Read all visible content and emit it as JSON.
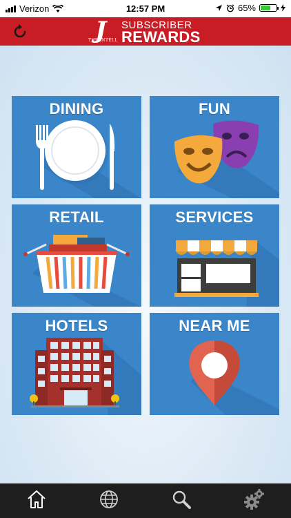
{
  "status_bar": {
    "carrier": "Verizon",
    "time": "12:57 PM",
    "battery": "65%",
    "battery_level": 0.65
  },
  "header": {
    "logo_letter": "J",
    "logo_sub": "THE INTELL",
    "title_top": "SUBSCRIBER",
    "title_bottom": "REWARDS"
  },
  "categories": [
    {
      "label": "DINING"
    },
    {
      "label": "FUN"
    },
    {
      "label": "RETAIL"
    },
    {
      "label": "SERVICES"
    },
    {
      "label": "HOTELS"
    },
    {
      "label": "NEAR ME"
    }
  ],
  "tabbar": {
    "icons": [
      "home-icon",
      "globe-icon",
      "search-icon",
      "settings-icon"
    ]
  },
  "colors": {
    "header_red": "#c81d24",
    "tile_blue": "#3a86c9",
    "tabbar": "#1e1e1e"
  }
}
